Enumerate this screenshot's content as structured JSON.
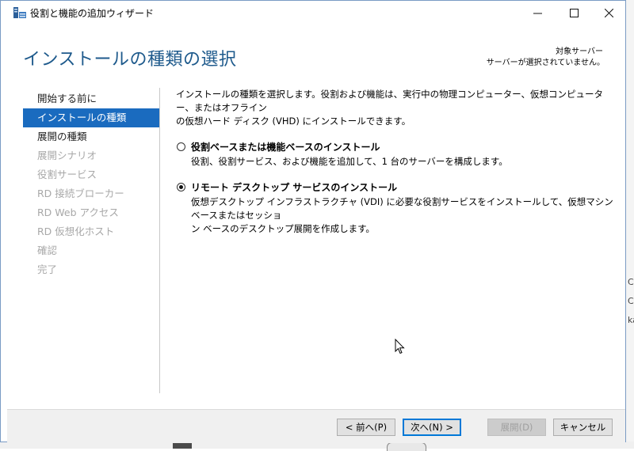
{
  "window": {
    "title": "役割と機能の追加ウィザード",
    "controls": {
      "minimize": "—",
      "maximize": "☐",
      "close": "✕"
    }
  },
  "header": {
    "page_title": "インストールの種類の選択",
    "target_server_label": "対象サーバー",
    "target_server_value": "サーバーが選択されていません。"
  },
  "nav": {
    "items": [
      {
        "label": "開始する前に",
        "state": "normal"
      },
      {
        "label": "インストールの種類",
        "state": "active"
      },
      {
        "label": "展開の種類",
        "state": "normal"
      },
      {
        "label": "展開シナリオ",
        "state": "disabled"
      },
      {
        "label": "役割サービス",
        "state": "disabled"
      },
      {
        "label": "RD 接続ブローカー",
        "state": "disabled"
      },
      {
        "label": "RD Web アクセス",
        "state": "disabled"
      },
      {
        "label": "RD 仮想化ホスト",
        "state": "disabled"
      },
      {
        "label": "確認",
        "state": "disabled"
      },
      {
        "label": "完了",
        "state": "disabled"
      }
    ]
  },
  "main": {
    "intro_line1": "インストールの種類を選択します。役割および機能は、実行中の物理コンピューター、仮想コンピューター、またはオフライン",
    "intro_line2": "の仮想ハード ディスク (VHD) にインストールできます。",
    "options": [
      {
        "title": "役割ベースまたは機能ベースのインストール",
        "desc1": "役割、役割サービス、および機能を追加して、1 台のサーバーを構成します。",
        "desc2": "",
        "selected": false
      },
      {
        "title": "リモート デスクトップ サービスのインストール",
        "desc1": "仮想デスクトップ インフラストラクチャ (VDI) に必要な役割サービスをインストールして、仮想マシン ベースまたはセッショ",
        "desc2": "ン ベースのデスクトップ展開を作成します。",
        "selected": true
      }
    ]
  },
  "footer": {
    "prev": "< 前へ(P)",
    "next": "次へ(N) >",
    "deploy": "展開(D)",
    "cancel": "キャンセル"
  },
  "background": {
    "frag1": "C",
    "frag2": "C",
    "frag3": "ka"
  },
  "colors": {
    "accent": "#1a6bbf",
    "title_blue": "#1e5a8c",
    "disabled_text": "#a8a8a8"
  }
}
